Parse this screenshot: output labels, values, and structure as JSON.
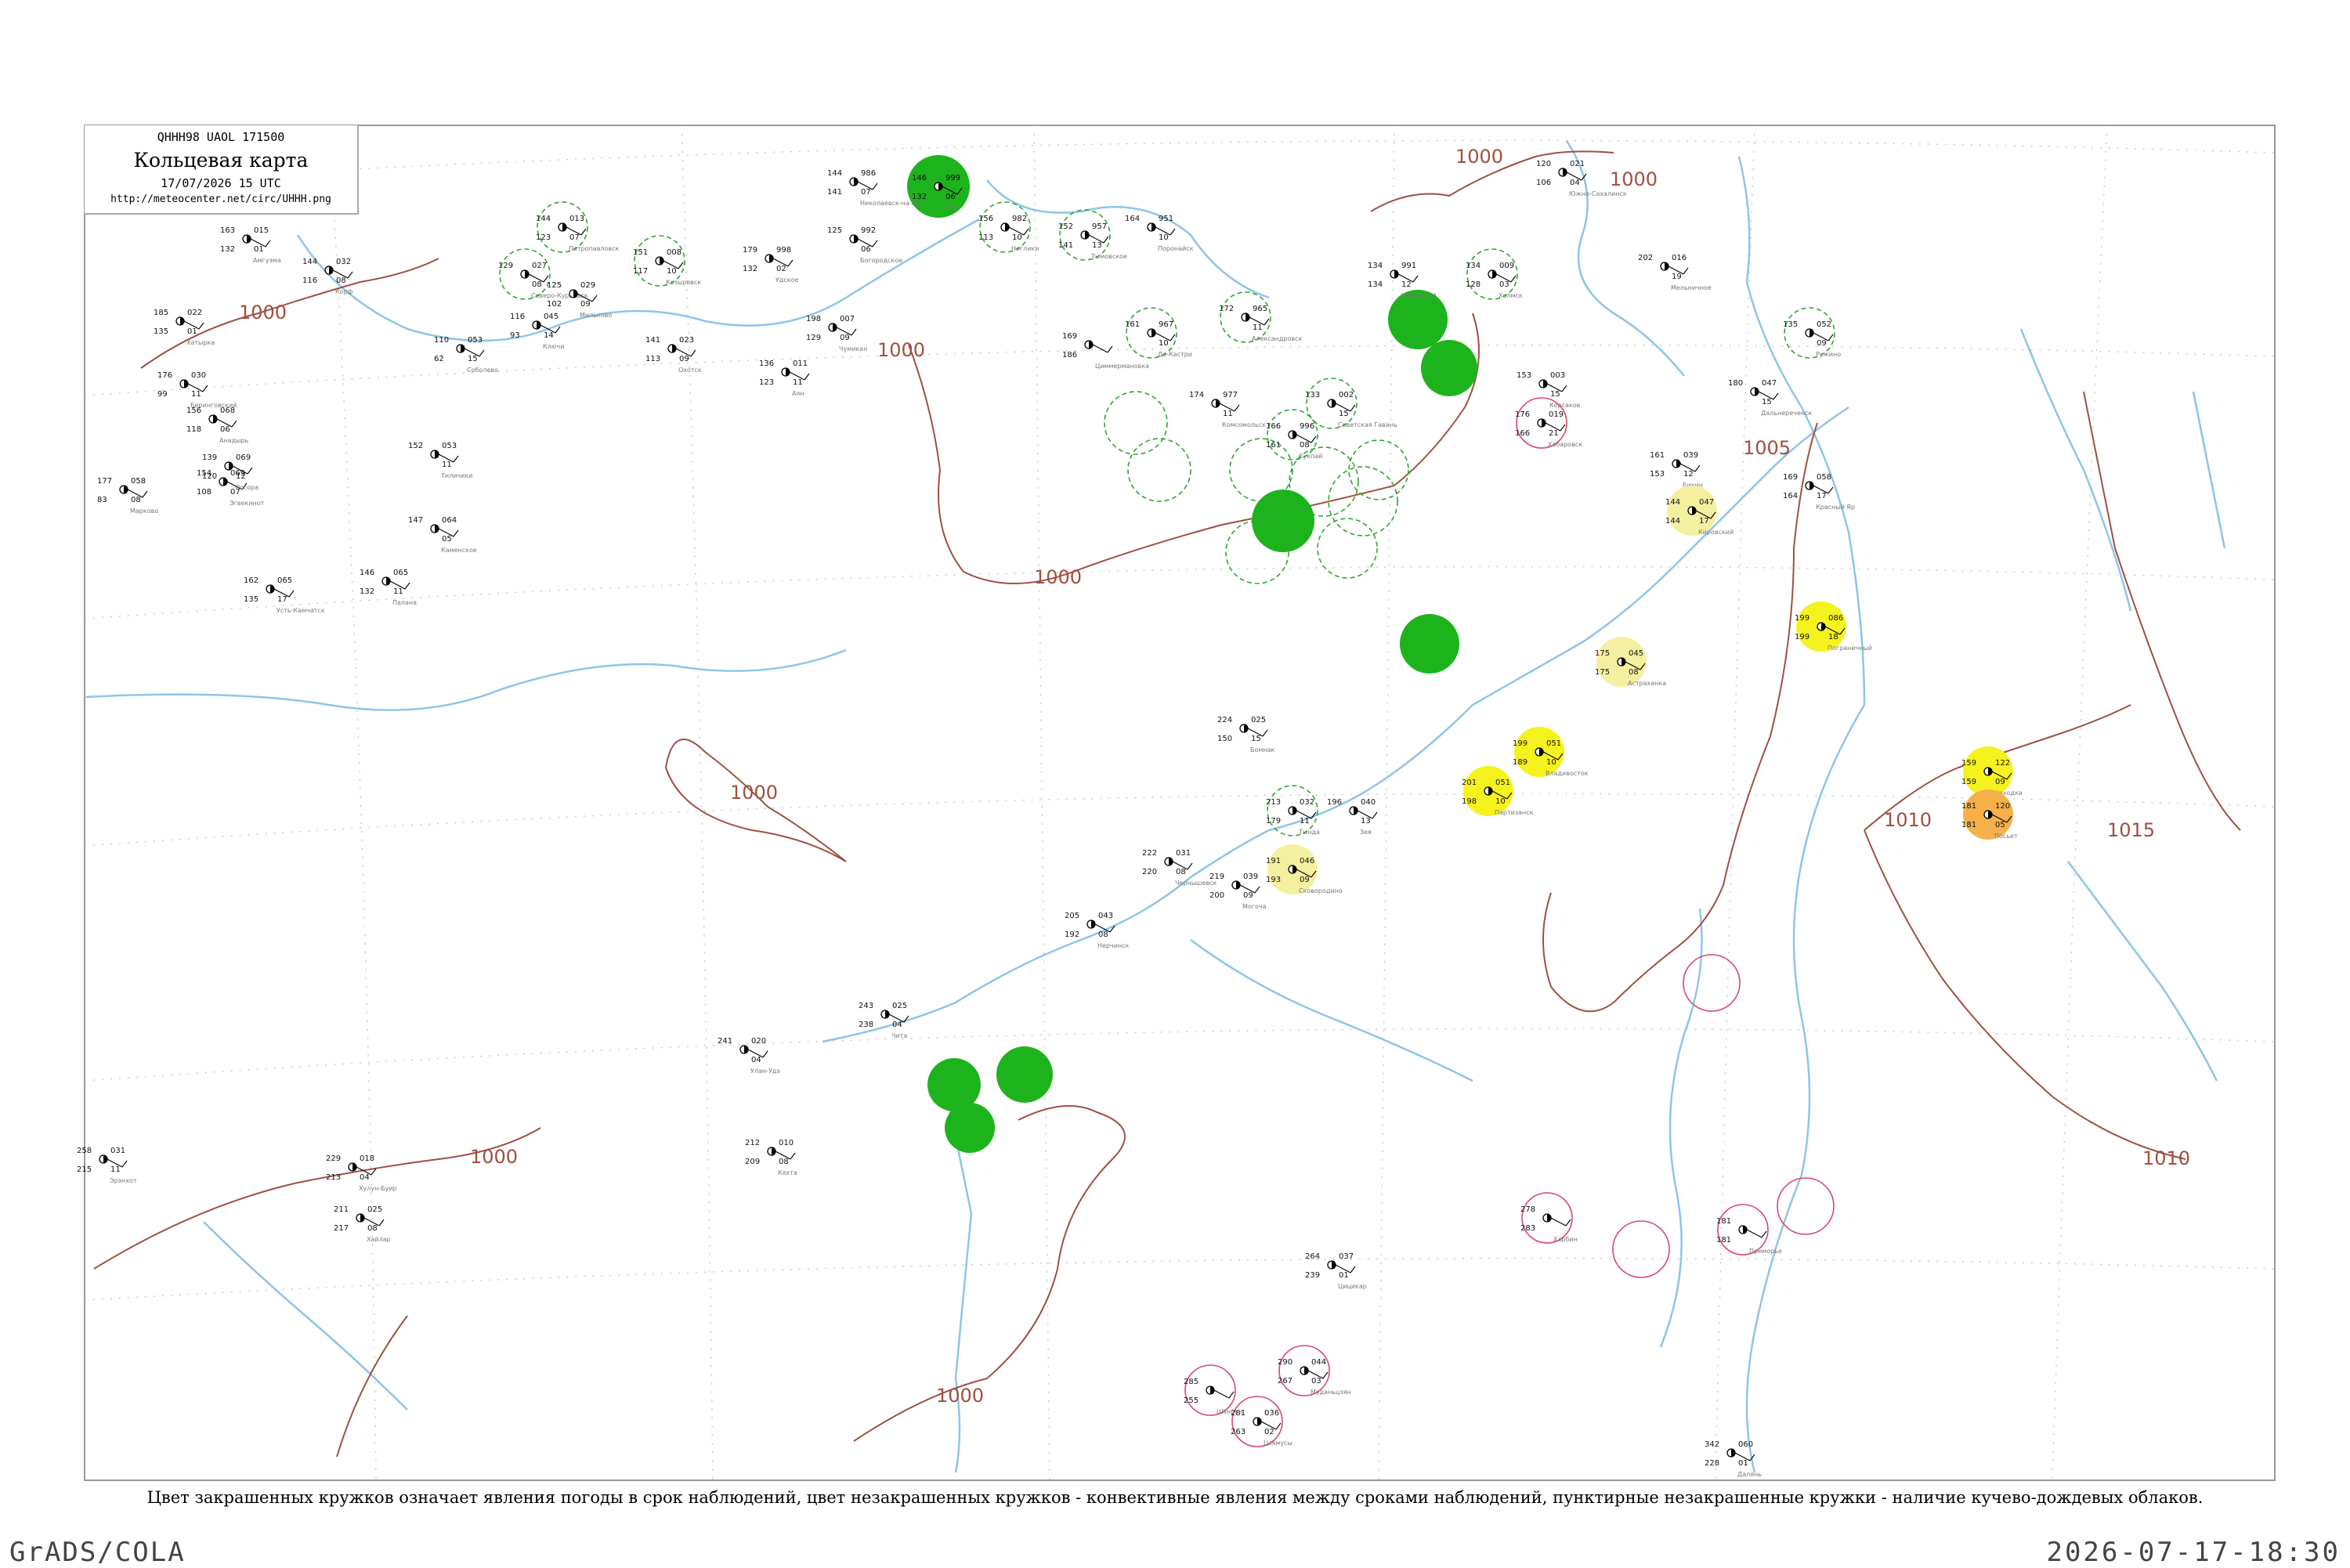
{
  "header": {
    "bulletin_code": "QHHH98  UAOL  171500",
    "title": "Кольцевая карта",
    "date_time": "17/07/2026 15 UTC",
    "url": "http://meteocenter.net/circ/UHHH.png"
  },
  "caption": "Цвет закрашенных кружков означает явления погоды в срок наблюдений, цвет незакрашенных кружков - конвективные явления между сроками наблюдений, пунктирные незакрашенные кружки - наличие кучево-дождевых облаков.",
  "footer": {
    "left": "GrADS/COLA",
    "right": "2026-07-17-18:30"
  },
  "colors": {
    "isobar": "#a05040",
    "rivers": "#8ec5e8",
    "frame": "#999999",
    "green": "#1db31d",
    "yellow": "#f6f21e",
    "pale_yellow": "#f5f0a0",
    "orange": "#f5b04a",
    "convective_red": "#d84a6a",
    "cb_green": "#2ea82e"
  },
  "isobar_labels": [
    {
      "text": "1000"
    },
    {
      "text": "1000"
    },
    {
      "text": "1000"
    },
    {
      "text": "1000"
    },
    {
      "text": "1000"
    },
    {
      "text": "1000"
    },
    {
      "text": "1000"
    },
    {
      "text": "1000"
    },
    {
      "text": "1005"
    },
    {
      "text": "1010"
    },
    {
      "text": "1010"
    },
    {
      "text": "1015"
    }
  ],
  "stations": [
    {
      "id": "s01",
      "temp": "163",
      "dew": "132",
      "pres": "015",
      "tend": "01",
      "name": "Амгуэма"
    },
    {
      "id": "s02",
      "temp": "144",
      "dew": "116",
      "pres": "032",
      "tend": "08",
      "name": "Корф"
    },
    {
      "id": "s03",
      "temp": "185",
      "dew": "135",
      "pres": "022",
      "tend": "01",
      "name": "Хатырка"
    },
    {
      "id": "s04",
      "temp": "176",
      "dew": "99",
      "pres": "030",
      "tend": "11",
      "name": "Беринговский"
    },
    {
      "id": "s05",
      "temp": "156",
      "dew": "118",
      "pres": "068",
      "tend": "06",
      "name": "Анадырь"
    },
    {
      "id": "s06",
      "temp": "154",
      "dew": "108",
      "pres": "069",
      "tend": "07",
      "name": "Эгвекинот"
    },
    {
      "id": "s07",
      "temp": "177",
      "dew": "83",
      "pres": "058",
      "tend": "08",
      "name": "Марково"
    },
    {
      "id": "s08",
      "temp": "162",
      "dew": "135",
      "pres": "065",
      "tend": "17",
      "name": "Усть-Камчатск"
    },
    {
      "id": "s09",
      "temp": "139",
      "dew": "120",
      "pres": "069",
      "tend": "12",
      "name": "Оссора"
    },
    {
      "id": "s10",
      "temp": "152",
      "dew": "",
      "pres": "053",
      "tend": "11",
      "name": "Тиличики"
    },
    {
      "id": "s11",
      "temp": "147",
      "dew": "",
      "pres": "064",
      "tend": "05",
      "name": "Каменское"
    },
    {
      "id": "s12",
      "temp": "146",
      "dew": "132",
      "pres": "065",
      "tend": "11",
      "name": "Палана"
    },
    {
      "id": "s13",
      "temp": "129",
      "dew": "",
      "pres": "027",
      "tend": "08",
      "name": "Северо-Курильск"
    },
    {
      "id": "s14",
      "temp": "144",
      "dew": "123",
      "pres": "013",
      "tend": "07",
      "name": "Петропавловск"
    },
    {
      "id": "s15",
      "temp": "116",
      "dew": "93",
      "pres": "045",
      "tend": "14",
      "name": "Ключи"
    },
    {
      "id": "s16",
      "temp": "110",
      "dew": "62",
      "pres": "053",
      "tend": "15",
      "name": "Соболево"
    },
    {
      "id": "s17",
      "temp": "125",
      "dew": "102",
      "pres": "029",
      "tend": "09",
      "name": "Мильково"
    },
    {
      "id": "s18",
      "temp": "151",
      "dew": "117",
      "pres": "008",
      "tend": "10",
      "name": "Козыревск"
    },
    {
      "id": "s19",
      "temp": "141",
      "dew": "113",
      "pres": "023",
      "tend": "09",
      "name": "Охотск"
    },
    {
      "id": "s20",
      "temp": "136",
      "dew": "123",
      "pres": "011",
      "tend": "11",
      "name": "Аян"
    },
    {
      "id": "s21",
      "temp": "198",
      "dew": "129",
      "pres": "007",
      "tend": "09",
      "name": "Чумикан"
    },
    {
      "id": "s22",
      "temp": "179",
      "dew": "132",
      "pres": "998",
      "tend": "02",
      "name": "Удское"
    },
    {
      "id": "s23",
      "temp": "144",
      "dew": "141",
      "pres": "986",
      "tend": "07",
      "name": "Николаевск-на-Амуре"
    },
    {
      "id": "s24",
      "temp": "125",
      "dew": "",
      "pres": "992",
      "tend": "06",
      "name": "Богородское"
    },
    {
      "id": "s25",
      "temp": "146",
      "dew": "132",
      "pres": "999",
      "tend": "06",
      "name": "Оха"
    },
    {
      "id": "s26",
      "temp": "156",
      "dew": "113",
      "pres": "982",
      "tend": "10",
      "name": "Ноглики"
    },
    {
      "id": "s27",
      "temp": "152",
      "dew": "141",
      "pres": "957",
      "tend": "13",
      "name": "Тымовское"
    },
    {
      "id": "s28",
      "temp": "164",
      "dew": "",
      "pres": "951",
      "tend": "10",
      "name": "Поронайск"
    },
    {
      "id": "s29",
      "temp": "172",
      "dew": "",
      "pres": "965",
      "tend": "11",
      "name": "Александровск"
    },
    {
      "id": "s30",
      "temp": "161",
      "dew": "",
      "pres": "967",
      "tend": "10",
      "name": "Де-Кастри"
    },
    {
      "id": "s31",
      "temp": "169",
      "dew": "186",
      "pres": "",
      "tend": "",
      "name": "Циммермановка"
    },
    {
      "id": "s32",
      "temp": "174",
      "dew": "",
      "pres": "977",
      "tend": "11",
      "name": "Комсомольск"
    },
    {
      "id": "s33",
      "temp": "166",
      "dew": "161",
      "pres": "996",
      "tend": "08",
      "name": "Сукпай"
    },
    {
      "id": "s34",
      "temp": "133",
      "dew": "",
      "pres": "002",
      "tend": "15",
      "name": "Советская Гавань"
    },
    {
      "id": "s35",
      "temp": "134",
      "dew": "134",
      "pres": "991",
      "tend": "12",
      "name": "Ильинский"
    },
    {
      "id": "s36",
      "temp": "134",
      "dew": "128",
      "pres": "009",
      "tend": "03",
      "name": "Холмск"
    },
    {
      "id": "s37",
      "temp": "120",
      "dew": "106",
      "pres": "021",
      "tend": "04",
      "name": "Южно-Сахалинск"
    },
    {
      "id": "s38",
      "temp": "153",
      "dew": "",
      "pres": "003",
      "tend": "15",
      "name": "Корсаков"
    },
    {
      "id": "s39",
      "temp": "176",
      "dew": "166",
      "pres": "019",
      "tend": "21",
      "name": "Хабаровск"
    },
    {
      "id": "s40",
      "temp": "161",
      "dew": "153",
      "pres": "039",
      "tend": "12",
      "name": "Бикин"
    },
    {
      "id": "s41",
      "temp": "169",
      "dew": "164",
      "pres": "058",
      "tend": "17",
      "name": "Красный Яр"
    },
    {
      "id": "s42",
      "temp": "180",
      "dew": "",
      "pres": "047",
      "tend": "15",
      "name": "Дальнереченск"
    },
    {
      "id": "s43",
      "temp": "135",
      "dew": "",
      "pres": "052",
      "tend": "09",
      "name": "Ружино"
    },
    {
      "id": "s44",
      "temp": "202",
      "dew": "",
      "pres": "016",
      "tend": "19",
      "name": "Мельничное"
    },
    {
      "id": "s45",
      "temp": "144",
      "dew": "144",
      "pres": "047",
      "tend": "17",
      "name": "Кировский"
    },
    {
      "id": "s46",
      "temp": "175",
      "dew": "175",
      "pres": "045",
      "tend": "08",
      "name": "Астраханка"
    },
    {
      "id": "s47",
      "temp": "199",
      "dew": "199",
      "pres": "086",
      "tend": "18",
      "name": "Пограничный"
    },
    {
      "id": "s48",
      "temp": "199",
      "dew": "189",
      "pres": "051",
      "tend": "10",
      "name": "Владивосток"
    },
    {
      "id": "s49",
      "temp": "201",
      "dew": "198",
      "pres": "051",
      "tend": "10",
      "name": "Партизанск"
    },
    {
      "id": "s50",
      "temp": "159",
      "dew": "159",
      "pres": "122",
      "tend": "09",
      "name": "Находка"
    },
    {
      "id": "s51",
      "temp": "181",
      "dew": "181",
      "pres": "120",
      "tend": "05",
      "name": "Посьет"
    },
    {
      "id": "s52",
      "temp": "191",
      "dew": "193",
      "pres": "046",
      "tend": "09",
      "name": "Сковородино"
    },
    {
      "id": "s53",
      "temp": "213",
      "dew": "179",
      "pres": "032",
      "tend": "11",
      "name": "Тында"
    },
    {
      "id": "s54",
      "temp": "196",
      "dew": "",
      "pres": "040",
      "tend": "13",
      "name": "Зея"
    },
    {
      "id": "s55",
      "temp": "224",
      "dew": "150",
      "pres": "025",
      "tend": "15",
      "name": "Бомнак"
    },
    {
      "id": "s56",
      "temp": "219",
      "dew": "200",
      "pres": "039",
      "tend": "09",
      "name": "Могоча"
    },
    {
      "id": "s57",
      "temp": "222",
      "dew": "220",
      "pres": "031",
      "tend": "08",
      "name": "Чернышевск"
    },
    {
      "id": "s58",
      "temp": "205",
      "dew": "192",
      "pres": "043",
      "tend": "08",
      "name": "Нерчинск"
    },
    {
      "id": "s59",
      "temp": "243",
      "dew": "238",
      "pres": "025",
      "tend": "04",
      "name": "Чита"
    },
    {
      "id": "s60",
      "temp": "241",
      "dew": "",
      "pres": "020",
      "tend": "04",
      "name": "Улан-Удэ"
    },
    {
      "id": "s61",
      "temp": "212",
      "dew": "209",
      "pres": "010",
      "tend": "08",
      "name": "Кяхта"
    },
    {
      "id": "s62",
      "temp": "258",
      "dew": "215",
      "pres": "031",
      "tend": "11",
      "name": "Эрэнхот"
    },
    {
      "id": "s63",
      "temp": "211",
      "dew": "217",
      "pres": "025",
      "tend": "08",
      "name": "Хайлар"
    },
    {
      "id": "s64",
      "temp": "229",
      "dew": "213",
      "pres": "018",
      "tend": "04",
      "name": "Хулун-Буир"
    },
    {
      "id": "s65",
      "temp": "264",
      "dew": "239",
      "pres": "037",
      "tend": "01",
      "name": "Цицикар"
    },
    {
      "id": "s66",
      "temp": "278",
      "dew": "283",
      "pres": "",
      "tend": "",
      "name": "Харбин"
    },
    {
      "id": "s67",
      "temp": "290",
      "dew": "267",
      "pres": "044",
      "tend": "03",
      "name": "Муданьцзян"
    },
    {
      "id": "s68",
      "temp": "281",
      "dew": "263",
      "pres": "036",
      "tend": "02",
      "name": "Цзямусы"
    },
    {
      "id": "s69",
      "temp": "285",
      "dew": "255",
      "pres": "",
      "tend": "",
      "name": "Шэньян"
    },
    {
      "id": "s70",
      "temp": "342",
      "dew": "228",
      "pres": "060",
      "tend": "01",
      "name": "Далянь"
    },
    {
      "id": "s71",
      "temp": "181",
      "dew": "181",
      "pres": "",
      "tend": "",
      "name": "Приморье"
    }
  ]
}
